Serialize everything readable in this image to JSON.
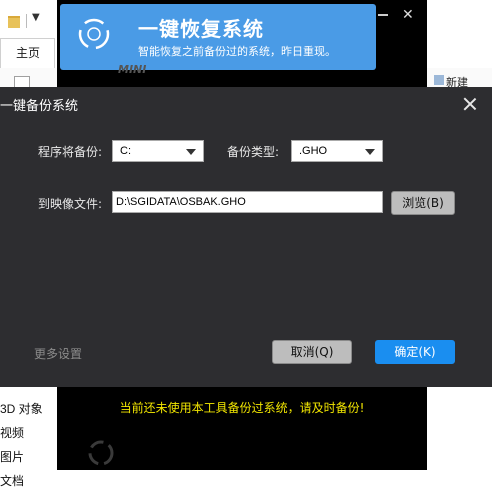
{
  "explorer": {
    "home_tab": "主页",
    "new_build": "新建",
    "tree_items": [
      "3D 对象",
      "视频",
      "图片",
      "文档"
    ]
  },
  "banner": {
    "title": "一键恢复系统",
    "subtitle": "智能恢复之前备份过的系统，昨日重现。",
    "mini_mark": "MINI",
    "notice": "当前还未使用本工具备份过系统，请及时备份!"
  },
  "dialog": {
    "title": "一键备份系统",
    "source_label": "程序将备份:",
    "source_value": "C:",
    "type_label": "备份类型:",
    "type_value": ".GHO",
    "image_label": "到映像文件:",
    "image_path": "D:\\SGIDATA\\OSBAK.GHO",
    "browse_label": "浏览(B)",
    "more_settings": "更多设置",
    "cancel_label": "取消(Q)",
    "ok_label": "确定(K)"
  },
  "colors": {
    "banner_blue": "#4a9be6",
    "dialog_bg": "#2d2d30",
    "ok_blue": "#1a8ef0",
    "notice_yellow": "#f2e600"
  },
  "icons": [
    "folder-icon",
    "restore-ring-icon",
    "close-icon",
    "dropdown-caret-icon",
    "loading-spinner-icon"
  ]
}
